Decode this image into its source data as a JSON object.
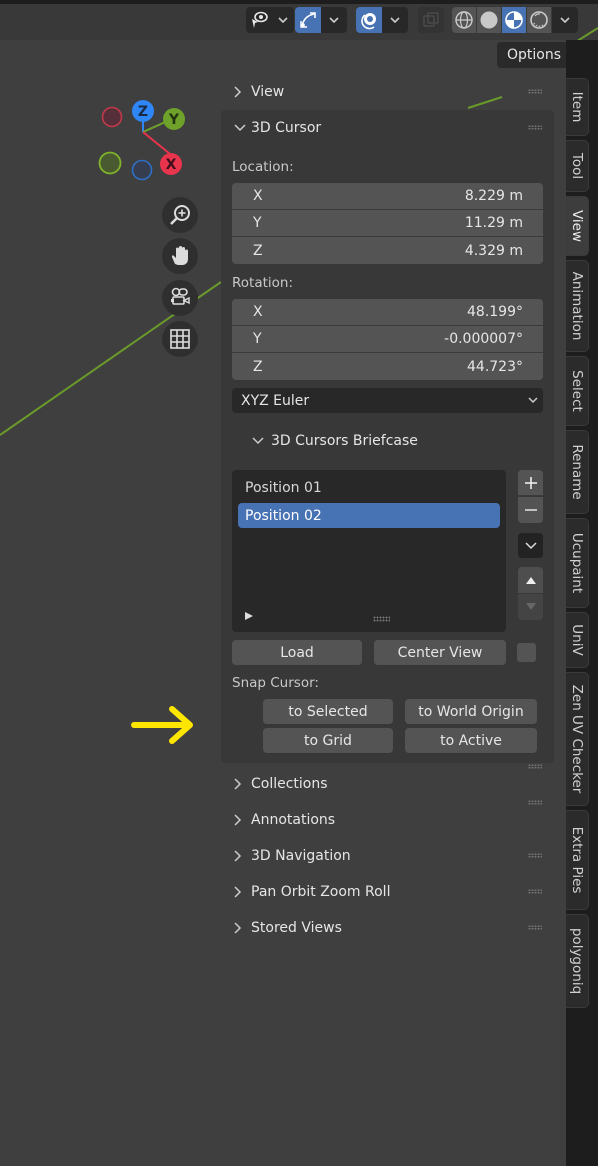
{
  "header": {
    "icons": [
      {
        "name": "visibility-eye-icon",
        "active": false
      },
      {
        "name": "gizmo-transform-icon",
        "active": true
      },
      {
        "name": "overlays-icon",
        "active": true
      },
      {
        "name": "xray-toggle-icon",
        "active": false
      }
    ],
    "shading_modes": [
      {
        "name": "wireframe-shading-icon",
        "active": false
      },
      {
        "name": "solid-shading-icon",
        "active": false
      },
      {
        "name": "material-preview-shading-icon",
        "active": true
      },
      {
        "name": "rendered-shading-icon",
        "active": false
      }
    ],
    "options_label": "Options"
  },
  "gizmo": {
    "axes": [
      {
        "label": "Z",
        "color": "#2f86f6"
      },
      {
        "label": "Y",
        "color": "#6ea22a"
      },
      {
        "label": "X",
        "color": "#e8344d"
      }
    ]
  },
  "nav_buttons": [
    "zoom-icon",
    "pan-hand-icon",
    "camera-view-icon",
    "ortho-grid-icon"
  ],
  "sidebar": {
    "panels_top": [
      {
        "label": "View",
        "expanded": false
      }
    ],
    "cursor_panel": {
      "title": "3D Cursor",
      "expanded": true,
      "location_label": "Location:",
      "location": [
        {
          "axis": "X",
          "value": "8.229 m"
        },
        {
          "axis": "Y",
          "value": "11.29 m"
        },
        {
          "axis": "Z",
          "value": "4.329 m"
        }
      ],
      "rotation_label": "Rotation:",
      "rotation": [
        {
          "axis": "X",
          "value": "48.199°"
        },
        {
          "axis": "Y",
          "value": "-0.000007°"
        },
        {
          "axis": "Z",
          "value": "44.723°"
        }
      ],
      "rotation_mode": "XYZ Euler",
      "briefcase": {
        "title": "3D Cursors Briefcase",
        "items": [
          {
            "label": "Position 01",
            "selected": false
          },
          {
            "label": "Position 02",
            "selected": true
          }
        ],
        "load_label": "Load",
        "center_view_label": "Center View"
      },
      "snap_label": "Snap Cursor:",
      "snap_buttons": [
        "to Selected",
        "to World Origin",
        "to Grid",
        "to Active"
      ]
    },
    "panels_bottom": [
      {
        "label": "Collections",
        "expanded": false
      },
      {
        "label": "Annotations",
        "expanded": false
      },
      {
        "label": "3D Navigation",
        "expanded": false
      },
      {
        "label": "Pan Orbit Zoom Roll",
        "expanded": false
      },
      {
        "label": "Stored Views",
        "expanded": false
      }
    ]
  },
  "tabs": [
    {
      "label": "Item",
      "active": false
    },
    {
      "label": "Tool",
      "active": false
    },
    {
      "label": "View",
      "active": true
    },
    {
      "label": "Animation",
      "active": false
    },
    {
      "label": "Select",
      "active": false
    },
    {
      "label": "Rename",
      "active": false
    },
    {
      "label": "Ucupaint",
      "active": false
    },
    {
      "label": "UniV",
      "active": false
    },
    {
      "label": "Zen UV Checker",
      "active": false
    },
    {
      "label": "Extra Pies",
      "active": false
    },
    {
      "label": "polygoniq",
      "active": false
    }
  ],
  "annotation": {
    "arrow_color": "#ffe600"
  }
}
